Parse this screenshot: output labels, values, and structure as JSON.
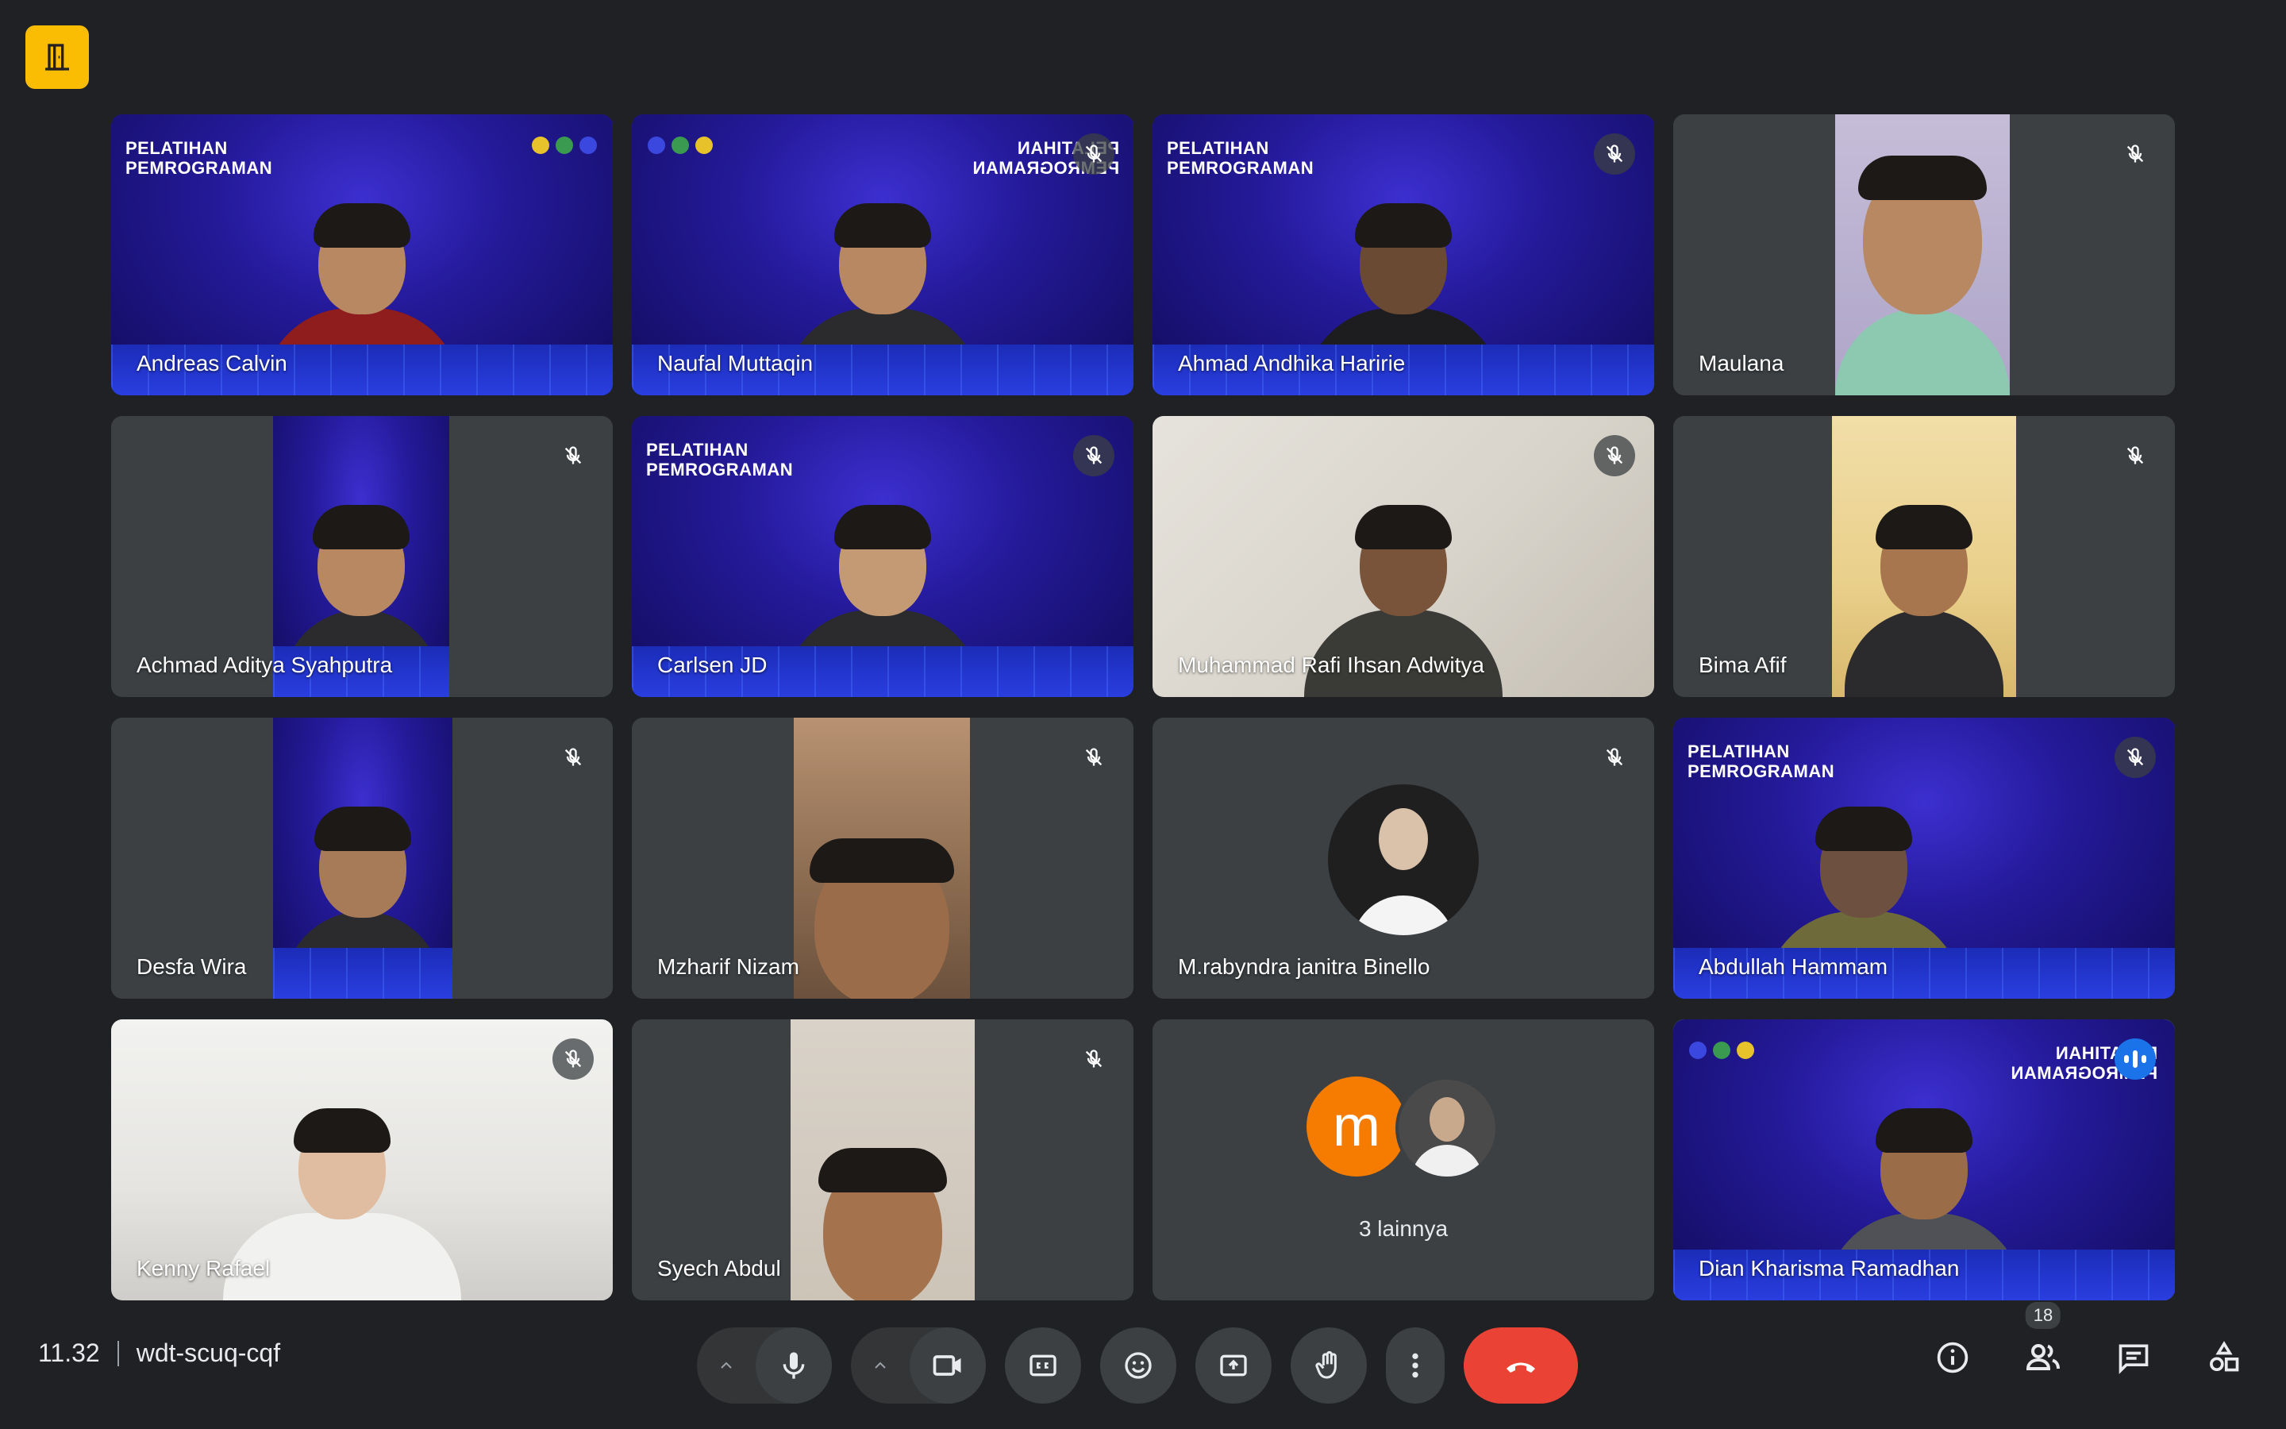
{
  "meeting": {
    "time": "11.32",
    "code": "wdt-scuq-cqf"
  },
  "banner": {
    "line1": "PELATIHAN",
    "line2": "PEMROGRAMAN"
  },
  "participants": [
    {
      "name": "Andreas Calvin",
      "muted": false,
      "bg": "blue"
    },
    {
      "name": "Naufal Muttaqin",
      "muted": true,
      "bg": "blue"
    },
    {
      "name": "Ahmad Andhika Haririe",
      "muted": true,
      "bg": "blue"
    },
    {
      "name": "Maulana",
      "muted": true,
      "bg": "lav"
    },
    {
      "name": "Achmad Aditya Syahputra",
      "muted": true,
      "bg": "blue"
    },
    {
      "name": "Carlsen JD",
      "muted": true,
      "bg": "blue"
    },
    {
      "name": "Muhammad Rafi Ihsan Adwitya",
      "muted": true,
      "bg": "room"
    },
    {
      "name": "Bima Afif",
      "muted": true,
      "bg": "wall"
    },
    {
      "name": "Desfa Wira",
      "muted": true,
      "bg": "blue"
    },
    {
      "name": "Mzharif Nizam",
      "muted": true,
      "bg": "dim"
    },
    {
      "name": "M.rabyndra janitra Binello",
      "muted": true,
      "bg": "avatar"
    },
    {
      "name": "Abdullah Hammam",
      "muted": true,
      "bg": "blue"
    },
    {
      "name": "Kenny Rafael",
      "muted": true,
      "bg": "office"
    },
    {
      "name": "Syech Abdul",
      "muted": true,
      "bg": "pale"
    },
    {
      "name": "",
      "muted": false,
      "bg": "more"
    },
    {
      "name": "Dian Kharisma Ramadhan",
      "muted": false,
      "bg": "blue",
      "speaking": true
    }
  ],
  "more_tile": {
    "initial": "m",
    "label": "3 lainnya",
    "initial_color": "#f57c00"
  },
  "people_count": "18",
  "colors": {
    "background": "#202124",
    "tile": "#3c4043",
    "end_call": "#ea4335",
    "speaking_outline": "#8ab4f8",
    "badge": "#fbbc04"
  },
  "icons": {
    "corner": "door-exit-icon",
    "mic": "microphone-icon",
    "camera": "video-camera-icon",
    "captions": "closed-captions-icon",
    "emoji": "emoji-icon",
    "present": "present-screen-icon",
    "hand": "raise-hand-icon",
    "more": "more-vertical-icon",
    "end": "end-call-icon",
    "info": "info-icon",
    "people": "people-icon",
    "chat": "chat-icon",
    "activities": "activities-icon"
  }
}
